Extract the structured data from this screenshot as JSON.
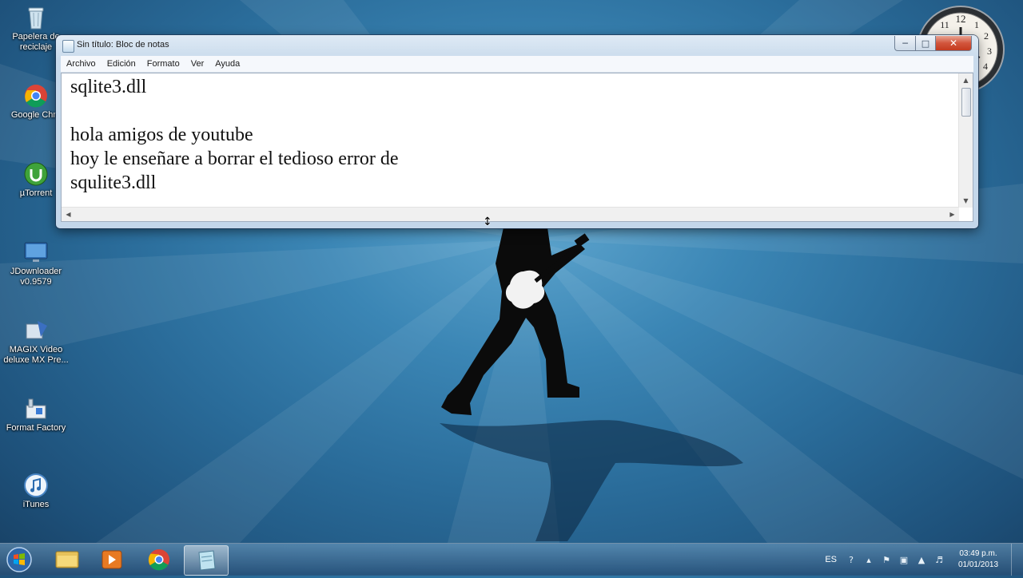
{
  "desktop": {
    "icons": [
      {
        "label": "Papelera de\nreciclaje",
        "icon": "recycle-bin-icon"
      },
      {
        "label": "Google Chro",
        "icon": "chrome-icon"
      },
      {
        "label": "µTorrent",
        "icon": "utorrent-icon"
      },
      {
        "label": "JDownloader\nv0.9579",
        "icon": "jdownloader-icon"
      },
      {
        "label": "MAGIX Video\ndeluxe MX Pre...",
        "icon": "magix-icon"
      },
      {
        "label": "Format Factory",
        "icon": "format-factory-icon"
      },
      {
        "label": "iTunes",
        "icon": "itunes-icon"
      }
    ],
    "gadget_clock_numerals": [
      "12",
      "1",
      "2",
      "3",
      "4",
      "11"
    ]
  },
  "notepad": {
    "title": "Sin título: Bloc de notas",
    "menu": [
      "Archivo",
      "Edición",
      "Formato",
      "Ver",
      "Ayuda"
    ],
    "content": "sqlite3.dll\n\nhola amigos de youtube\nhoy le enseñare a borrar el tedioso error de\nsqulite3.dll",
    "controls": {
      "minimize": "minimize-icon",
      "maximize": "maximize-icon",
      "close": "close-icon"
    }
  },
  "taskbar": {
    "pinned": [
      "explorer-icon",
      "media-player-icon",
      "chrome-icon",
      "notepad-icon"
    ],
    "active": "notepad-icon",
    "tray": {
      "language": "ES",
      "icons": [
        "help-icon",
        "tray-arrow-icon",
        "action-center-icon",
        "network-icon",
        "signal-icon",
        "volume-icon"
      ],
      "time": "03:49 p.m.",
      "date": "01/01/2013"
    }
  },
  "colors": {
    "accent_close": "#c43a1f",
    "desktop": "#2a6c9a"
  }
}
